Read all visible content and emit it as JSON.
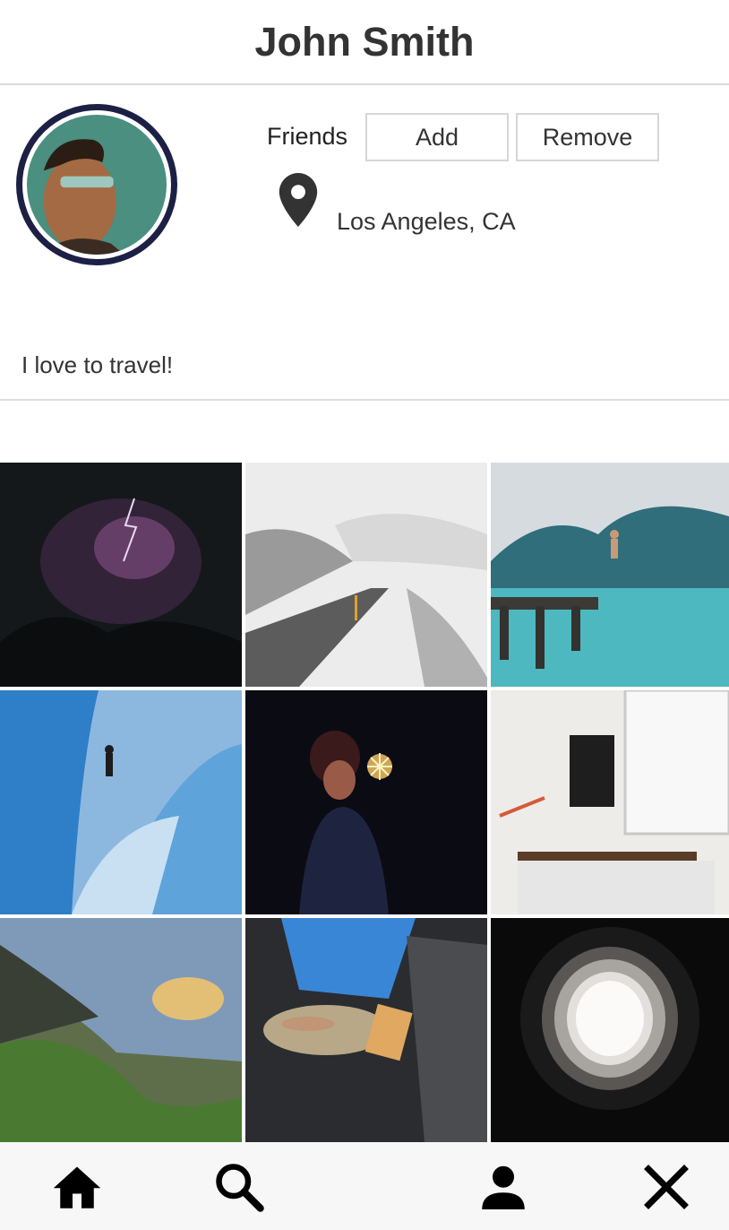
{
  "header": {
    "title": "John Smith"
  },
  "profile": {
    "friends_label": "Friends",
    "add_label": "Add",
    "remove_label": "Remove",
    "location": "Los Angeles, CA",
    "bio": "I love to travel!"
  },
  "photos": [
    "lightning-storm",
    "snowy-road",
    "pier-jumpers",
    "ice-cave",
    "sparkler-portrait",
    "desk-workspace",
    "green-cliffs",
    "fish-in-hands",
    "spiral-tunnel"
  ],
  "nav": [
    "home-icon",
    "search-icon",
    "profile-icon",
    "close-icon"
  ],
  "colors": {
    "avatar_ring": "#1d2045",
    "text": "#333333",
    "divider": "#dcdcdc"
  }
}
